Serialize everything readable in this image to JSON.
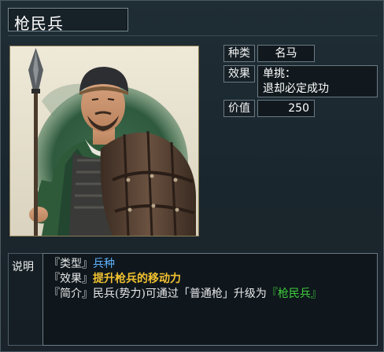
{
  "unit": {
    "name": "枪民兵"
  },
  "attributes": {
    "kind_label": "种类",
    "kind_value": "名马",
    "effect_label": "效果",
    "effect_line1": "单挑：",
    "effect_line2": "退却必定成功",
    "value_label": "价值",
    "value_value": "250"
  },
  "description": {
    "label": "说明",
    "type_bracket_open": "『类型』",
    "type_value": "兵种",
    "effect_bracket_open": "『效果』",
    "effect_value": "提升枪兵的移动力",
    "intro_bracket_open": "『简介』",
    "intro_text_1": "民兵(势力)可通过「普通枪」升级为",
    "intro_highlight": "『枪民兵』"
  },
  "colors": {
    "type_value": "#5fb3ff",
    "effect_value": "#f2c230",
    "intro_highlight": "#3fcf3a"
  }
}
